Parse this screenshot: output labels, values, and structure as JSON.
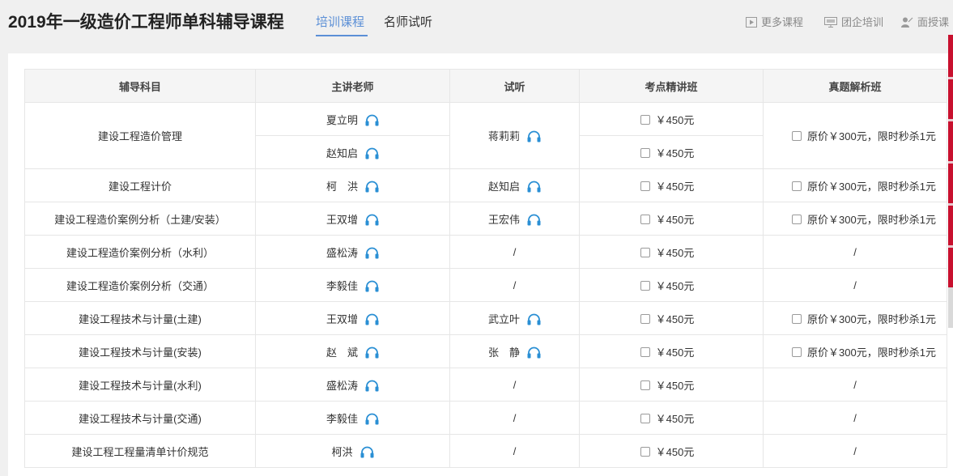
{
  "header": {
    "title": "2019年一级造价工程师单科辅导课程",
    "tabs": [
      {
        "label": "培训课程",
        "active": true
      },
      {
        "label": "名师试听",
        "active": false
      }
    ],
    "links": [
      {
        "label": "更多课程",
        "icon": "video-icon"
      },
      {
        "label": "团企培训",
        "icon": "monitor-icon"
      },
      {
        "label": "面授课",
        "icon": "teacher-icon"
      }
    ]
  },
  "table": {
    "headers": [
      "辅导科目",
      "主讲老师",
      "试听",
      "考点精讲班",
      "真题解析班"
    ],
    "first_group": {
      "subject": "建设工程造价管理",
      "teachers": [
        "夏立明",
        "赵知启"
      ],
      "trial": "蒋莉莉",
      "prices": [
        "￥450元",
        "￥450元"
      ],
      "exam": "原价￥300元，限时秒杀1元"
    },
    "rows": [
      {
        "subject": "建设工程计价",
        "teacher": "柯　洪",
        "trial": "赵知启",
        "trial_audio": true,
        "price": "￥450元",
        "exam": "原价￥300元，限时秒杀1元",
        "exam_check": true
      },
      {
        "subject": "建设工程造价案例分析（土建/安装）",
        "teacher": "王双增",
        "trial": "王宏伟",
        "trial_audio": true,
        "price": "￥450元",
        "exam": "原价￥300元，限时秒杀1元",
        "exam_check": true
      },
      {
        "subject": "建设工程造价案例分析（水利）",
        "teacher": "盛松涛",
        "trial": "/",
        "trial_audio": false,
        "price": "￥450元",
        "exam": "/",
        "exam_check": false
      },
      {
        "subject": "建设工程造价案例分析（交通）",
        "teacher": "李毅佳",
        "trial": "/",
        "trial_audio": false,
        "price": "￥450元",
        "exam": "/",
        "exam_check": false
      },
      {
        "subject": "建设工程技术与计量(土建)",
        "teacher": "王双增",
        "trial": "武立叶",
        "trial_audio": true,
        "price": "￥450元",
        "exam": "原价￥300元，限时秒杀1元",
        "exam_check": true
      },
      {
        "subject": "建设工程技术与计量(安装)",
        "teacher": "赵　斌",
        "trial": "张　静",
        "trial_audio": true,
        "price": "￥450元",
        "exam": "原价￥300元，限时秒杀1元",
        "exam_check": true
      },
      {
        "subject": "建设工程技术与计量(水利)",
        "teacher": "盛松涛",
        "trial": "/",
        "trial_audio": false,
        "price": "￥450元",
        "exam": "/",
        "exam_check": false
      },
      {
        "subject": "建设工程技术与计量(交通)",
        "teacher": "李毅佳",
        "trial": "/",
        "trial_audio": false,
        "price": "￥450元",
        "exam": "/",
        "exam_check": false
      },
      {
        "subject": "建设工程工程量清单计价规范",
        "teacher": "柯洪",
        "trial": "/",
        "trial_audio": false,
        "price": "￥450元",
        "exam": "/",
        "exam_check": false
      }
    ]
  },
  "colors": {
    "accent": "#5b8fd6",
    "headphone": "#2a8fd4",
    "side_bar": "#c8102e"
  }
}
